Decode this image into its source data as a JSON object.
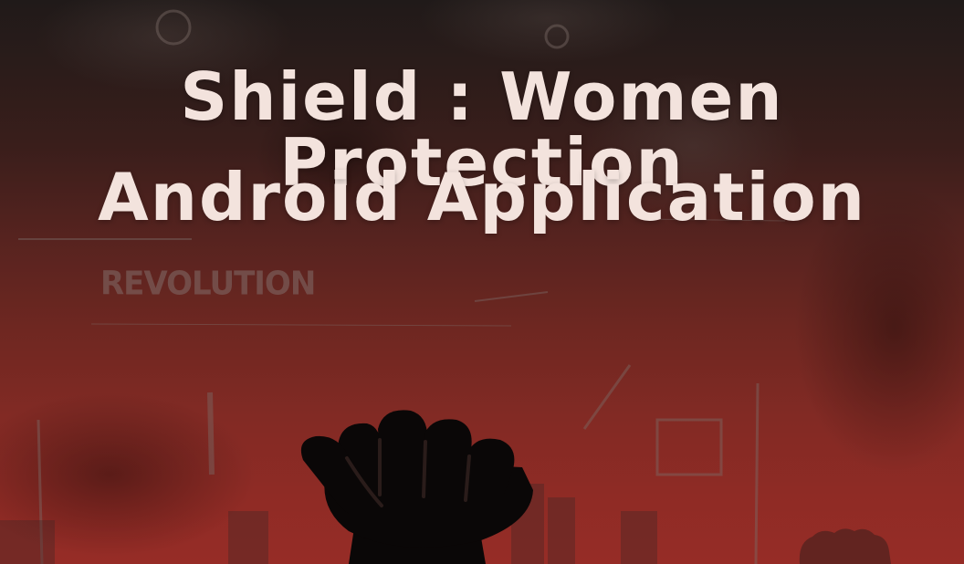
{
  "poster": {
    "title_line_1": "Shield : Women Protection",
    "title_line_2": "Android Application",
    "background_word": "REVOLUTION"
  },
  "colors": {
    "title": "#f3e3dd",
    "background_top": "#201a19",
    "background_bottom": "#962c26",
    "fist": "#0a0707"
  },
  "icons": {
    "main": "raised-fist-icon",
    "secondary": "raised-fist-icon"
  }
}
